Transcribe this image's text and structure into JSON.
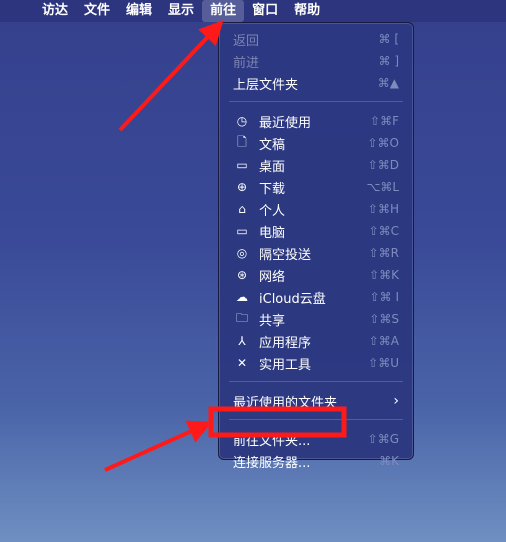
{
  "menubar": {
    "apple": "",
    "items": [
      "访达",
      "文件",
      "编辑",
      "显示",
      "前往",
      "窗口",
      "帮助"
    ],
    "active": "前往"
  },
  "menu": {
    "top": [
      {
        "label": "返回",
        "shortcut": "⌘ [",
        "disabled": true
      },
      {
        "label": "前进",
        "shortcut": "⌘ ]",
        "disabled": true
      },
      {
        "label": "上层文件夹",
        "shortcut": "⌘▲",
        "disabled": false
      }
    ],
    "places": [
      {
        "icon": "clock-icon",
        "glyph": "◷",
        "label": "最近使用",
        "shortcut": "⇧⌘F"
      },
      {
        "icon": "document-icon",
        "glyph": "🗋",
        "label": "文稿",
        "shortcut": "⇧⌘O"
      },
      {
        "icon": "desktop-icon",
        "glyph": "▭",
        "label": "桌面",
        "shortcut": "⇧⌘D"
      },
      {
        "icon": "download-icon",
        "glyph": "⊕",
        "label": "下载",
        "shortcut": "⌥⌘L"
      },
      {
        "icon": "home-icon",
        "glyph": "⌂",
        "label": "个人",
        "shortcut": "⇧⌘H"
      },
      {
        "icon": "computer-icon",
        "glyph": "▭",
        "label": "电脑",
        "shortcut": "⇧⌘C"
      },
      {
        "icon": "airdrop-icon",
        "glyph": "◎",
        "label": "隔空投送",
        "shortcut": "⇧⌘R"
      },
      {
        "icon": "network-icon",
        "glyph": "⊛",
        "label": "网络",
        "shortcut": "⇧⌘K"
      },
      {
        "icon": "cloud-icon",
        "glyph": "☁",
        "label": "iCloud云盘",
        "shortcut": "⇧⌘ I"
      },
      {
        "icon": "shared-folder-icon",
        "glyph": "🗀",
        "label": "共享",
        "shortcut": "⇧⌘S"
      },
      {
        "icon": "applications-icon",
        "glyph": "⅄",
        "label": "应用程序",
        "shortcut": "⇧⌘A"
      },
      {
        "icon": "utilities-icon",
        "glyph": "✕",
        "label": "实用工具",
        "shortcut": "⇧⌘U"
      }
    ],
    "recent": {
      "label": "最近使用的文件夹",
      "arrow": "›"
    },
    "bottom": [
      {
        "label": "前往文件夹...",
        "shortcut": "⇧⌘G"
      },
      {
        "label": "连接服务器...",
        "shortcut": "⌘K"
      }
    ]
  },
  "annotation_color": "#ff1a1a"
}
